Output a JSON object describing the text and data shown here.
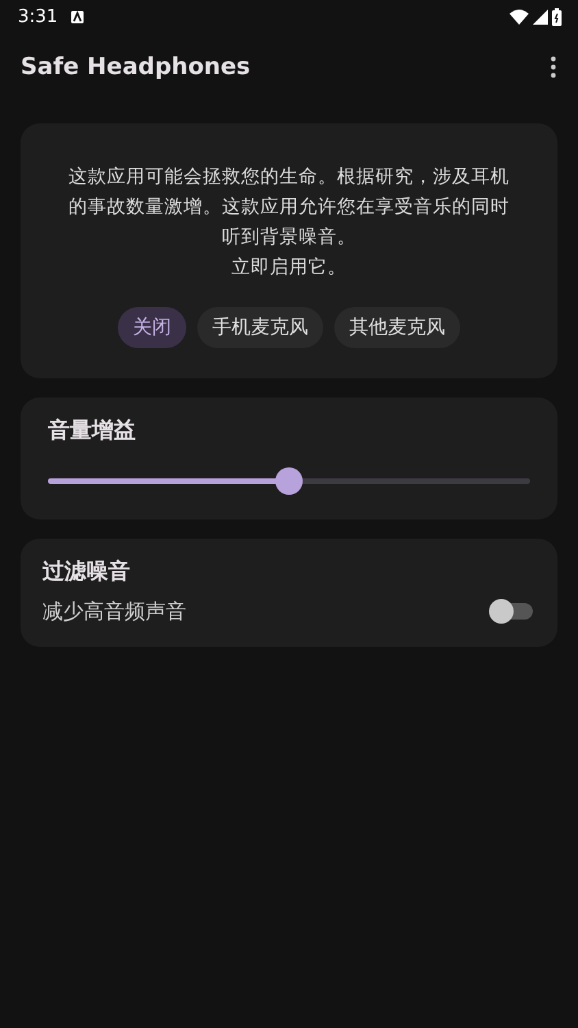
{
  "status_bar": {
    "time": "3:31"
  },
  "app_bar": {
    "title": "Safe Headphones"
  },
  "intro": {
    "message": "这款应用可能会拯救您的生命。根据研究，涉及耳机的事故数量激增。这款应用允许您在享受音乐的同时听到背景噪音。",
    "call_to_action": "立即启用它。",
    "modes": [
      {
        "label": "关闭",
        "selected": true
      },
      {
        "label": "手机麦克风",
        "selected": false
      },
      {
        "label": "其他麦克风",
        "selected": false
      }
    ]
  },
  "volume_gain": {
    "title": "音量增益",
    "level": 0.5
  },
  "noise_filter": {
    "title": "过滤噪音",
    "label": "减少高音频声音",
    "on": false
  }
}
